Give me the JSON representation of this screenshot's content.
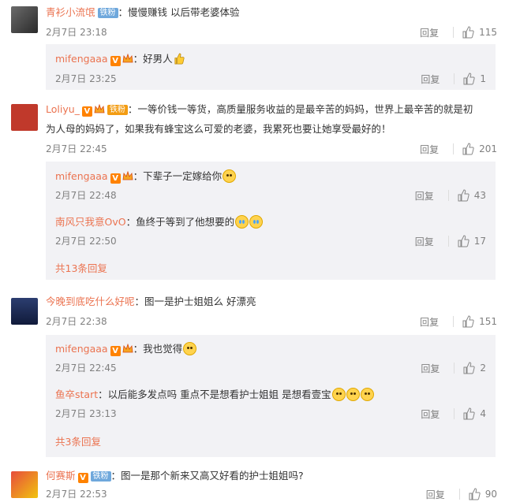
{
  "comments": [
    {
      "user": "青衫小流氓",
      "badge": "铁粉",
      "text": "：慢慢赚钱  以后带老婆体验",
      "time": "2月7日 23:18",
      "reply": "回复",
      "likes": "115",
      "replies": [
        {
          "user": "mifengaaa",
          "text": "：好男人",
          "time": "2月7日 23:25",
          "reply": "回复",
          "likes": "1"
        }
      ]
    },
    {
      "user": "Loliyu_",
      "badge": "铁粉",
      "text_line1": "：一等价钱一等货，高质量服务收益的是最辛苦的妈妈，世界上最辛苦的就是初",
      "text_line2": "为人母的妈妈了，如果我有蜂宝这么可爱的老婆，我累死也要让她享受最好的！",
      "time": "2月7日 22:45",
      "reply": "回复",
      "likes": "201",
      "replies": [
        {
          "user": "mifengaaa",
          "text": "：下辈子一定嫁给你",
          "time": "2月7日 22:48",
          "reply": "回复",
          "likes": "43"
        },
        {
          "user": "南风只我意OvO",
          "text": "：鱼终于等到了他想要的",
          "time": "2月7日 22:50",
          "reply": "回复",
          "likes": "17"
        }
      ],
      "more": "共13条回复"
    },
    {
      "user": "今晚到底吃什么好呢",
      "text": "：图一是护士姐姐么  好漂亮",
      "time": "2月7日 22:38",
      "reply": "回复",
      "likes": "151",
      "replies": [
        {
          "user": "mifengaaa",
          "text": "：我也觉得",
          "time": "2月7日 22:45",
          "reply": "回复",
          "likes": "2"
        },
        {
          "user": "鱼卒start",
          "text": "：以后能多发点吗 重点不是想看护士姐姐 是想看壹宝",
          "time": "2月7日 23:13",
          "reply": "回复",
          "likes": "4"
        }
      ],
      "more": "共3条回复"
    },
    {
      "user": "何赛斯",
      "badge": "铁粉",
      "text": "：图一是那个新来又高又好看的护士姐姐吗?",
      "time": "2月7日 22:53",
      "reply": "回复",
      "likes": "90"
    }
  ],
  "colors": {
    "username": "#eb7350",
    "meta": "#808080",
    "reply_bg": "#f2f2f5"
  },
  "icons": [
    "thumbs-up-icon",
    "vip-crown-icon",
    "verified-v-icon",
    "smiley-emoji",
    "crying-emoji"
  ]
}
